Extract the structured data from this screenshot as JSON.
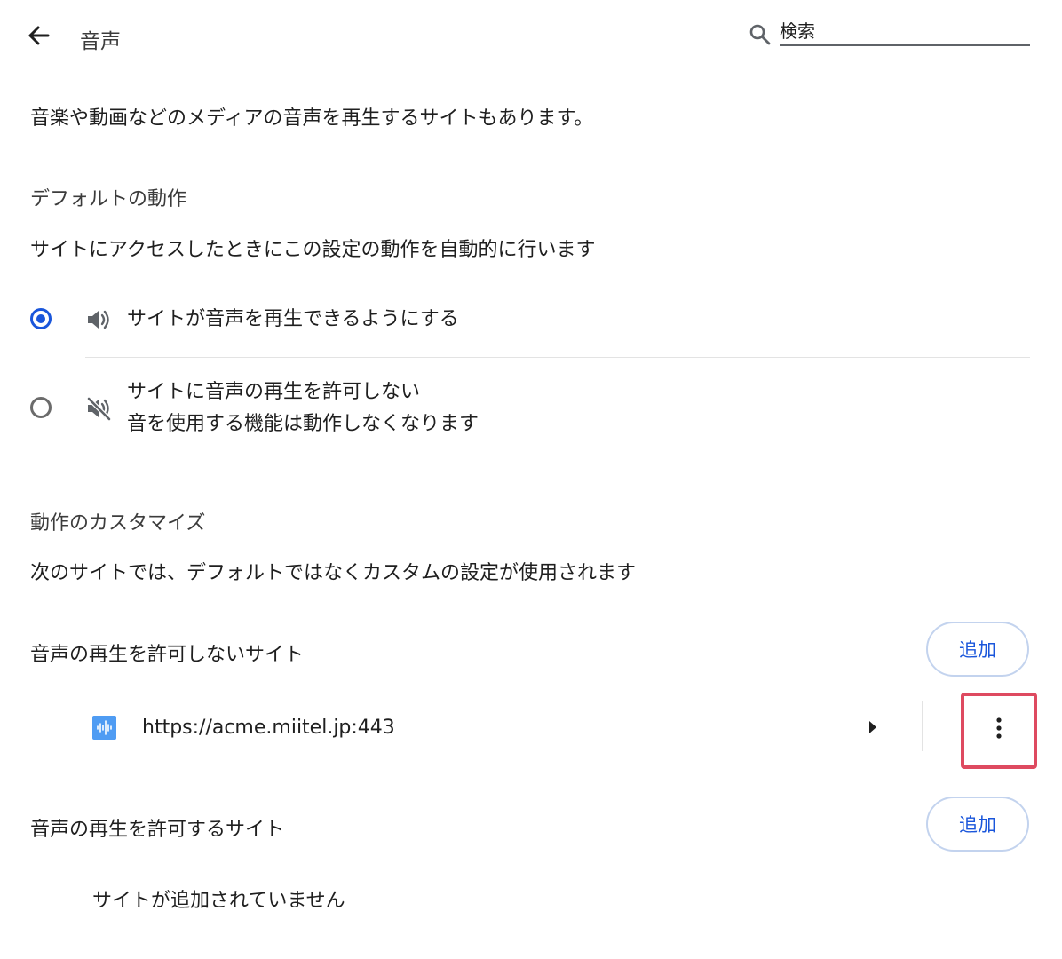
{
  "header": {
    "title": "音声",
    "search_placeholder": "検索"
  },
  "intro": "音楽や動画などのメディアの音声を再生するサイトもあります。",
  "default_behavior": {
    "heading": "デフォルトの動作",
    "description": "サイトにアクセスしたときにこの設定の動作を自動的に行います",
    "options": [
      {
        "label": "サイトが音声を再生できるようにする",
        "selected": true,
        "icon": "volume-icon"
      },
      {
        "label": "サイトに音声の再生を許可しない",
        "sublabel": "音を使用する機能は動作しなくなります",
        "selected": false,
        "icon": "volume-off-icon"
      }
    ]
  },
  "customize": {
    "heading": "動作のカスタマイズ",
    "description": "次のサイトでは、デフォルトではなくカスタムの設定が使用されます"
  },
  "blocked_sites": {
    "heading": "音声の再生を許可しないサイト",
    "add_label": "追加",
    "sites": [
      {
        "url": "https://acme.miitel.jp:443"
      }
    ]
  },
  "allowed_sites": {
    "heading": "音声の再生を許可するサイト",
    "add_label": "追加",
    "empty_text": "サイトが追加されていません"
  },
  "colors": {
    "accent": "#1a56db",
    "highlight": "#de4a60",
    "favicon": "#4f9cf3"
  }
}
